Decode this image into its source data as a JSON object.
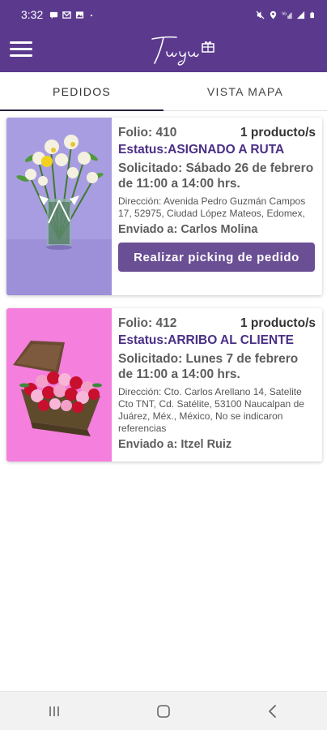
{
  "statusbar": {
    "time": "3:32",
    "left_icons": [
      "message-icon",
      "gmail-icon",
      "image-icon",
      "dot-icon"
    ],
    "right_icons": [
      "mute-icon",
      "location-icon",
      "volte-signal-icon",
      "signal-icon",
      "battery-icon"
    ]
  },
  "header": {
    "logo_text": "Tuyu",
    "bg_color": "#5b3a8e"
  },
  "tabs": [
    {
      "label": "PEDIDOS",
      "active": true
    },
    {
      "label": "VISTA MAPA",
      "active": false
    }
  ],
  "orders": [
    {
      "folio": "Folio: 410",
      "products": "1 producto/s",
      "status": "Estatus:ASIGNADO A RUTA",
      "requested_line1": "Solicitado: Sábado 26 de febrero",
      "requested_line2": "de 11:00 a 14:00 hrs.",
      "address": "Dirección: Avenida Pedro Guzmán Campos 17, 52975, Ciudad López Mateos, Edomex,",
      "sent_to": "Enviado a: Carlos Molina",
      "action_label": "Realizar picking de pedido",
      "image": "white-yellow-flowers-vase"
    },
    {
      "folio": "Folio: 412",
      "products": "1 producto/s",
      "status": "Estatus:ARRIBO AL CLIENTE",
      "requested_line1": "Solicitado: Lunes 7 de febrero",
      "requested_line2": "de 11:00 a 14:00 hrs.",
      "address": "Dirección: Cto. Carlos Arellano 14, Satelite Cto TNT, Cd. Satélite, 53100 Naucalpan de Juárez, Méx., México, No se indicaron referencias",
      "sent_to": "Enviado a: Itzel Ruiz",
      "image": "carnations-treasure-chest"
    }
  ],
  "navbar": {
    "buttons": [
      "recents-icon",
      "home-icon",
      "back-icon"
    ]
  },
  "colors": {
    "accent": "#4a2f86",
    "button": "#6a4f95"
  }
}
